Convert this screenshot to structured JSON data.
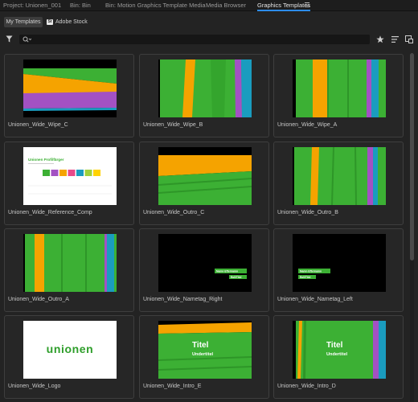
{
  "panel_tabs": [
    {
      "label": "Project: Unionen_001",
      "active": false
    },
    {
      "label": "Bin: Bin",
      "active": false
    },
    {
      "label": "Bin: Motion Graphics Template Media",
      "active": false
    },
    {
      "label": "Media Browser",
      "active": false
    },
    {
      "label": "Graphics Templates",
      "active": true
    }
  ],
  "sub_tabs": {
    "my_templates": "My Templates",
    "adobe_stock": "Adobe Stock",
    "stock_badge": "St"
  },
  "search": {
    "value": "",
    "placeholder": ""
  },
  "colors": {
    "accent": "#2d8ceb",
    "green": "#3cb034",
    "orange": "#f5a300",
    "purple": "#a351c3",
    "teal": "#1a9cbf",
    "lime": "#9fd13b"
  },
  "templates": [
    {
      "label": "Unionen_Wide_Wipe_C",
      "thumb": "wipe-c"
    },
    {
      "label": "Unionen_Wide_Wipe_B",
      "thumb": "wipe-b"
    },
    {
      "label": "Unionen_Wide_Wipe_A",
      "thumb": "wipe-a"
    },
    {
      "label": "Unionen_Wide_Reference_Comp",
      "thumb": "reference"
    },
    {
      "label": "Unionen_Wide_Outro_C",
      "thumb": "outro-c"
    },
    {
      "label": "Unionen_Wide_Outro_B",
      "thumb": "outro-b"
    },
    {
      "label": "Unionen_Wide_Outro_A",
      "thumb": "outro-a"
    },
    {
      "label": "Unionen_Wide_Nametag_Right",
      "thumb": "nametag-right"
    },
    {
      "label": "Unionen_Wide_Nametag_Left",
      "thumb": "nametag-left"
    },
    {
      "label": "Unionen_Wide_Logo",
      "thumb": "logo"
    },
    {
      "label": "Unionen_Wide_Intro_E",
      "thumb": "intro-e"
    },
    {
      "label": "Unionen_Wide_Intro_D",
      "thumb": "intro-d"
    }
  ],
  "thumb_text": {
    "reference_title": "Unionen Profilfärger",
    "nametag_name": "Namn Efternamn",
    "nametag_role": "Roll/Titel",
    "logo_text": "unionen",
    "intro_title": "Titel",
    "intro_subtitle": "Undertitel"
  }
}
